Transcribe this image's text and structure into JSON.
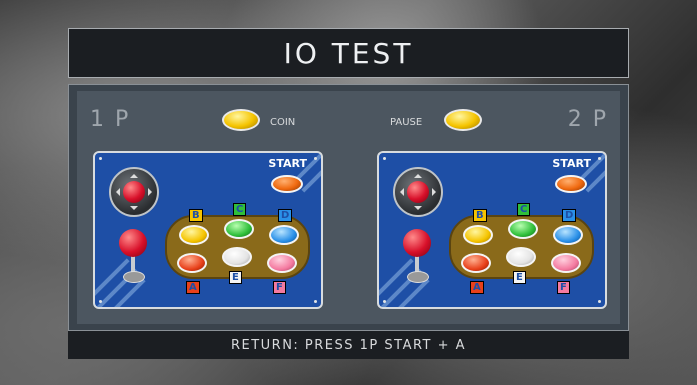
{
  "title": "IO TEST",
  "player1": {
    "label": "1 P"
  },
  "player2": {
    "label": "2 P"
  },
  "coin_label": "COIN",
  "pause_label": "PAUSE",
  "panel": {
    "start_label": "START",
    "buttons": [
      {
        "letter": "B",
        "color": "#f5c400"
      },
      {
        "letter": "C",
        "color": "#2fbf3a"
      },
      {
        "letter": "D",
        "color": "#2a90e8"
      },
      {
        "letter": "A",
        "color": "#e8401a"
      },
      {
        "letter": "E",
        "color": "#f4f4f4"
      },
      {
        "letter": "F",
        "color": "#f47aa0"
      }
    ]
  },
  "footer": "RETURN: PRESS 1P START + A",
  "colors": {
    "panel_blue": "#1e4fa6",
    "coin_yellow": "#f5c400",
    "start_orange": "#f06a10"
  }
}
